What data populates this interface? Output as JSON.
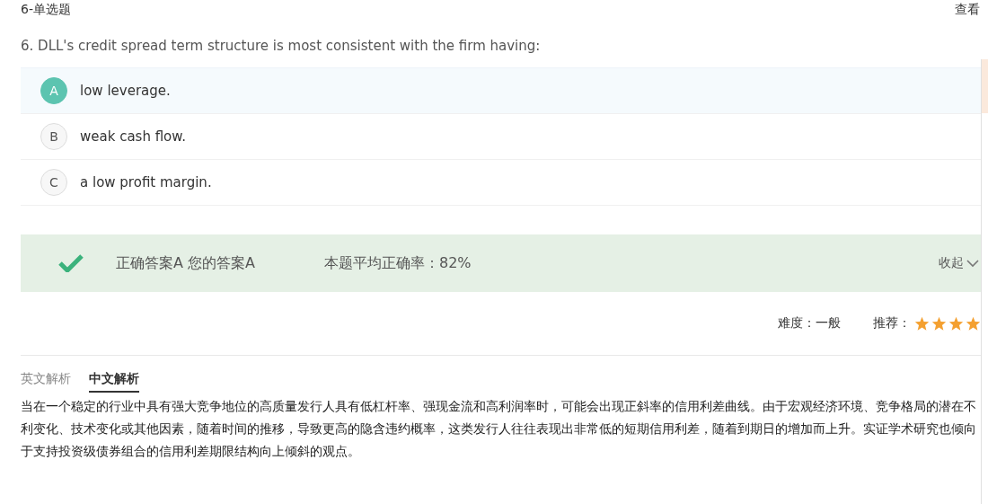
{
  "header": {
    "title": "6-单选题",
    "link": "查看"
  },
  "question": "6. DLL's credit spread term structure is most consistent with the firm having:",
  "options": [
    {
      "letter": "A",
      "text": "low leverage.",
      "selected": true
    },
    {
      "letter": "B",
      "text": "weak cash flow.",
      "selected": false
    },
    {
      "letter": "C",
      "text": "a low profit margin.",
      "selected": false
    }
  ],
  "result": {
    "correct": true,
    "answers": "正确答案A 您的答案A",
    "rate": "本题平均正确率：82%",
    "toggle": "收起"
  },
  "meta": {
    "difficulty": "难度：一般",
    "recommend_label": "推荐：",
    "stars": 4
  },
  "tabs": [
    {
      "label": "英文解析",
      "selected": false
    },
    {
      "label": "中文解析",
      "selected": true
    }
  ],
  "explanation": "当在一个稳定的行业中具有强大竞争地位的高质量发行人具有低杠杆率、强现金流和高利润率时，可能会出现正斜率的信用利差曲线。由于宏观经济环境、竞争格局的潜在不利变化、技术变化或其他因素，随着时间的推移，导致更高的隐含违约概率，这类发行人往往表现出非常低的短期信用利差，随着到期日的增加而上升。实证学术研究也倾向于支持投资级债券组合的信用利差期限结构向上倾斜的观点。"
}
